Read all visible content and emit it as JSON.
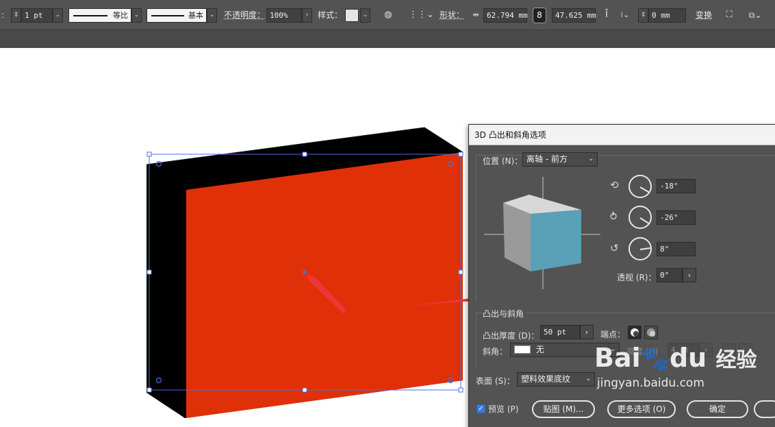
{
  "toolbar": {
    "stroke_weight": "1 pt",
    "profile_label": "等比",
    "brush_label": "基本",
    "opacity_label": "不透明度：",
    "opacity_value": "100%",
    "style_label": "样式：",
    "shape_label": "形状：",
    "width_value": "62.794 mm",
    "height_value": "47.625 mm",
    "radius_value": "0 mm",
    "transform_label": "变换"
  },
  "dialog": {
    "title": "3D 凸出和斜角选项",
    "position_label": "位置 (N)：",
    "position_value": "离轴 - 前方",
    "rot_x": "-18°",
    "rot_y": "-26°",
    "rot_z": "8°",
    "perspective_label": "透视 (R)：",
    "perspective_value": "0°",
    "extrude_section": "凸出与斜角",
    "depth_label": "凸出厚度 (D)：",
    "depth_value": "50 pt",
    "cap_label": "端点：",
    "bevel_label": "斜角：",
    "bevel_value": "无",
    "height_label": "高度 (H)",
    "height_value": "4 pt",
    "surface_label": "表面 (S)：",
    "surface_value": "塑料效果底纹",
    "preview_label": "预览 (P)",
    "map_button": "贴图 (M)...",
    "more_button": "更多选项 (O)",
    "ok_button": "确定"
  },
  "watermark": {
    "brand": "Bai",
    "brand2": "du",
    "suffix": "经验",
    "url": "jingyan.baidu.com"
  },
  "colors": {
    "front_face": "#e03008",
    "side_face": "#000000",
    "cube_front": "#5aa0b6",
    "arrow": "#f0353a",
    "selection": "#4a6fd8"
  }
}
